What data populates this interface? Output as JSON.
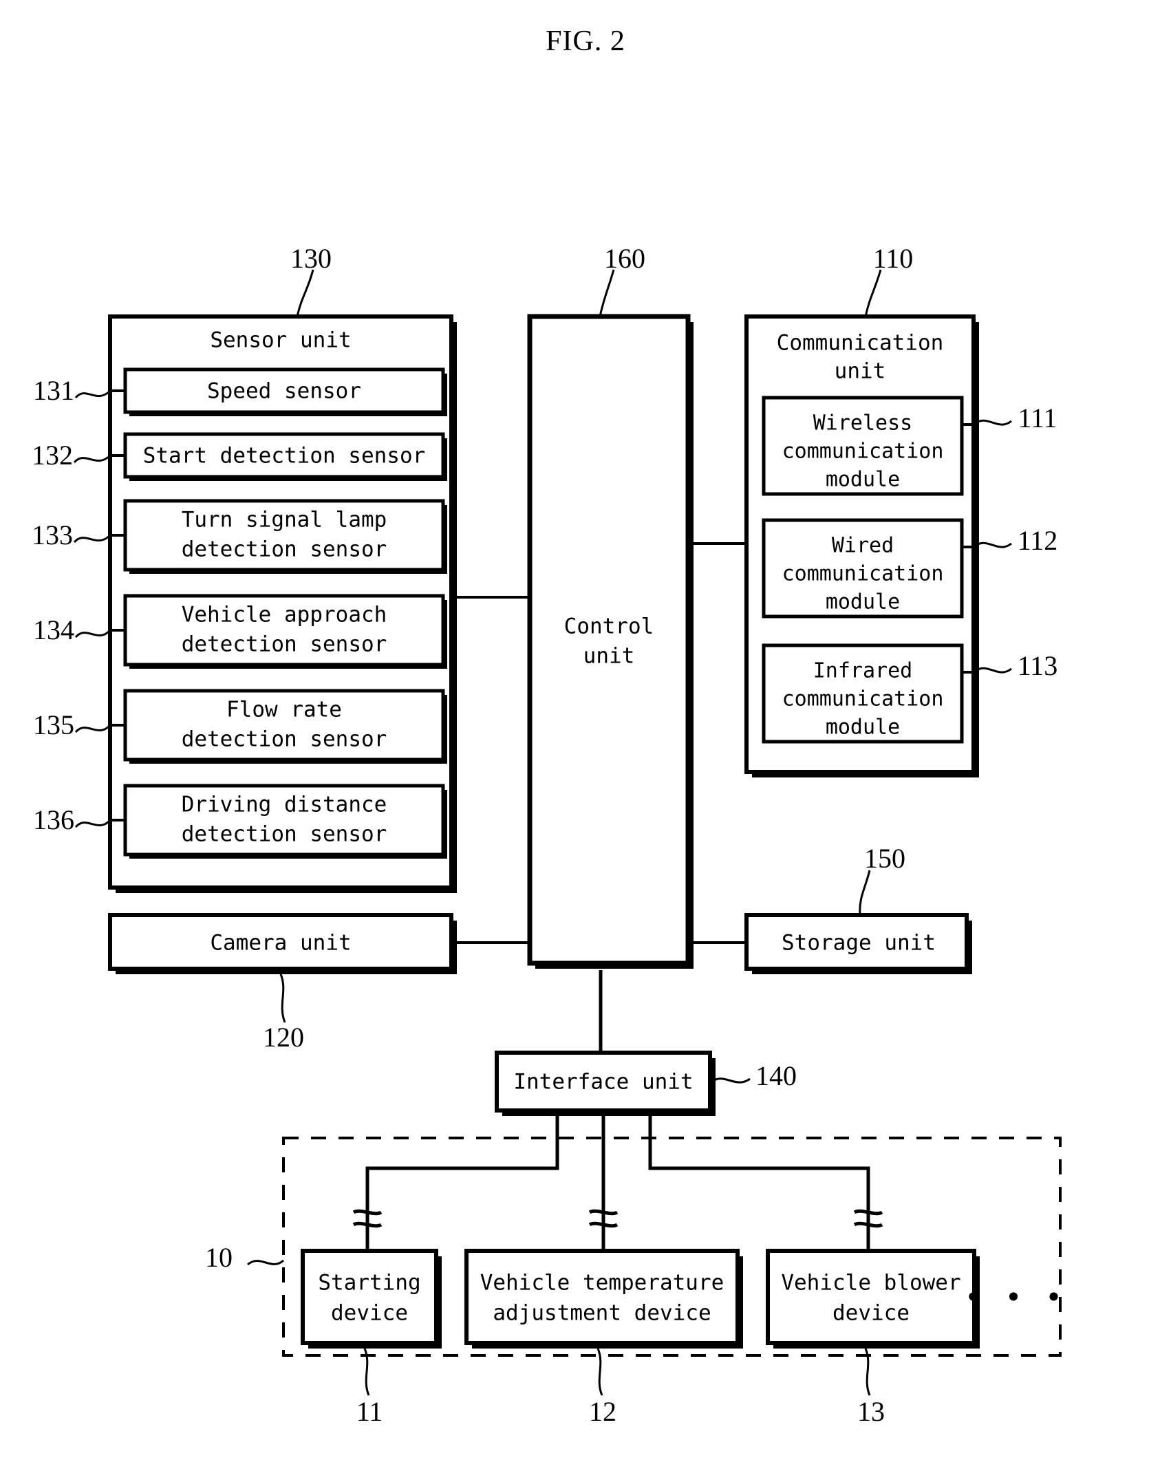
{
  "figure": {
    "title": "FIG. 2"
  },
  "sensor_unit": {
    "ref": "130",
    "title": "Sensor unit",
    "sensors": [
      {
        "ref": "131",
        "line1": "Speed sensor",
        "line2": ""
      },
      {
        "ref": "132",
        "line1": "Start detection sensor",
        "line2": ""
      },
      {
        "ref": "133",
        "line1": "Turn signal lamp",
        "line2": "detection sensor"
      },
      {
        "ref": "134",
        "line1": "Vehicle approach",
        "line2": "detection sensor"
      },
      {
        "ref": "135",
        "line1": "Flow rate",
        "line2": "detection sensor"
      },
      {
        "ref": "136",
        "line1": "Driving distance",
        "line2": "detection sensor"
      }
    ]
  },
  "control_unit": {
    "ref": "160",
    "line1": "Control",
    "line2": "unit"
  },
  "communication_unit": {
    "ref": "110",
    "line1": "Communication",
    "line2": "unit",
    "modules": [
      {
        "ref": "111",
        "line1": "Wireless",
        "line2": "communication",
        "line3": "module"
      },
      {
        "ref": "112",
        "line1": "Wired",
        "line2": "communication",
        "line3": "module"
      },
      {
        "ref": "113",
        "line1": "Infrared",
        "line2": "communication",
        "line3": "module"
      }
    ]
  },
  "camera_unit": {
    "ref": "120",
    "title": "Camera unit"
  },
  "storage_unit": {
    "ref": "150",
    "title": "Storage unit"
  },
  "interface_unit": {
    "ref": "140",
    "title": "Interface unit"
  },
  "external_devices": {
    "ref": "10",
    "ellipsis": "• • •",
    "devices": [
      {
        "ref": "11",
        "line1": "Starting",
        "line2": "device"
      },
      {
        "ref": "12",
        "line1": "Vehicle temperature",
        "line2": "adjustment device"
      },
      {
        "ref": "13",
        "line1": "Vehicle blower",
        "line2": "device"
      }
    ]
  }
}
